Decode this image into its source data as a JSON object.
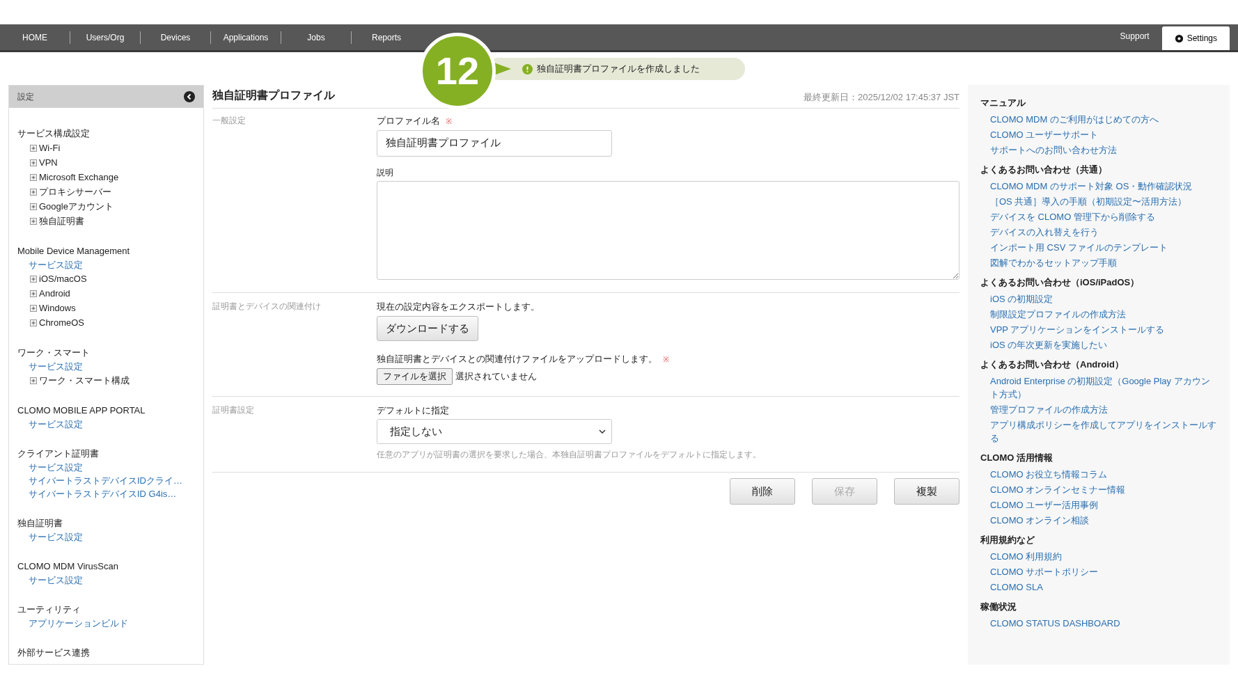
{
  "nav": {
    "left": [
      {
        "label": "HOME",
        "selected": false
      },
      {
        "label": "Users/Org",
        "selected": false
      },
      {
        "label": "Devices",
        "selected": false
      },
      {
        "label": "Applications",
        "selected": false
      },
      {
        "label": "Jobs",
        "selected": false
      },
      {
        "label": "Reports",
        "selected": false
      }
    ],
    "right": [
      {
        "label": "Support",
        "selected": false,
        "icon": false
      },
      {
        "label": "Settings",
        "selected": true,
        "icon": true
      }
    ]
  },
  "step_badge": "12",
  "toast": {
    "message": "独自証明書プロファイルを作成しました"
  },
  "sidebar": {
    "title": "設定",
    "sections": [
      {
        "title": "サービス構成設定",
        "items": [
          {
            "label": "Wi-Fi",
            "kind": "tree"
          },
          {
            "label": "VPN",
            "kind": "tree"
          },
          {
            "label": "Microsoft Exchange",
            "kind": "tree"
          },
          {
            "label": "プロキシサーバー",
            "kind": "tree"
          },
          {
            "label": "Googleアカウント",
            "kind": "tree"
          },
          {
            "label": "独自証明書",
            "kind": "tree"
          }
        ]
      },
      {
        "title": "Mobile Device Management",
        "items": [
          {
            "label": "サービス設定",
            "kind": "link"
          },
          {
            "label": "iOS/macOS",
            "kind": "tree"
          },
          {
            "label": "Android",
            "kind": "tree"
          },
          {
            "label": "Windows",
            "kind": "tree"
          },
          {
            "label": "ChromeOS",
            "kind": "tree"
          }
        ]
      },
      {
        "title": "ワーク・スマート",
        "items": [
          {
            "label": "サービス設定",
            "kind": "link"
          },
          {
            "label": "ワーク・スマート構成",
            "kind": "tree"
          }
        ]
      },
      {
        "title": "CLOMO MOBILE APP PORTAL",
        "items": [
          {
            "label": "サービス設定",
            "kind": "link"
          }
        ]
      },
      {
        "title": "クライアント証明書",
        "items": [
          {
            "label": "サービス設定",
            "kind": "link"
          },
          {
            "label": "サイバートラストデバイスIDクライ…",
            "kind": "link"
          },
          {
            "label": "サイバートラストデバイスID G4is…",
            "kind": "link"
          }
        ]
      },
      {
        "title": "独自証明書",
        "items": [
          {
            "label": "サービス設定",
            "kind": "link"
          }
        ]
      },
      {
        "title": "CLOMO MDM VirusScan",
        "items": [
          {
            "label": "サービス設定",
            "kind": "link"
          }
        ]
      },
      {
        "title": "ユーティリティ",
        "items": [
          {
            "label": "アプリケーションビルド",
            "kind": "link"
          }
        ]
      },
      {
        "title": "外部サービス連携"
      }
    ]
  },
  "main": {
    "title": "独自証明書プロファイル",
    "updated": "最終更新日：2025/12/02 17:45:37 JST",
    "general": {
      "label": "一般設定",
      "name_label": "プロファイル名",
      "required_mark": "※",
      "name_value": "独自証明書プロファイル",
      "desc_label": "説明"
    },
    "association": {
      "label": "証明書とデバイスの関連付け",
      "export_text": "現在の設定内容をエクスポートします。",
      "download_button": "ダウンロードする",
      "upload_text": "独自証明書とデバイスとの関連付けファイルをアップロードします。",
      "required_mark": "※",
      "file_button": "ファイルを選択",
      "file_status": "選択されていません"
    },
    "cert": {
      "label": "証明書設定",
      "default_label": "デフォルトに指定",
      "default_value": "指定しない",
      "hint": "任意のアプリが証明書の選択を要求した場合、本独自証明書プロファイルをデフォルトに指定します。"
    },
    "buttons": [
      {
        "label": "削除",
        "disabled": false
      },
      {
        "label": "保存",
        "disabled": true
      },
      {
        "label": "複製",
        "disabled": false
      }
    ]
  },
  "help": [
    {
      "title": "マニュアル",
      "links": [
        "CLOMO MDM のご利用がはじめての方へ",
        "CLOMO ユーザーサポート",
        "サポートへのお問い合わせ方法"
      ]
    },
    {
      "title": "よくあるお問い合わせ（共通）",
      "links": [
        "CLOMO MDM のサポート対象 OS・動作確認状況",
        "［OS 共通］導入の手順（初期設定〜活用方法）",
        "デバイスを CLOMO 管理下から削除する",
        "デバイスの入れ替えを行う",
        "インポート用 CSV ファイルのテンプレート",
        "図解でわかるセットアップ手順"
      ]
    },
    {
      "title": "よくあるお問い合わせ（iOS/iPadOS）",
      "links": [
        "iOS の初期設定",
        "制限設定プロファイルの作成方法",
        "VPP アプリケーションをインストールする",
        "iOS の年次更新を実施したい"
      ]
    },
    {
      "title": "よくあるお問い合わせ（Android）",
      "links": [
        "Android Enterprise の初期設定（Google Play アカウント方式）",
        "管理プロファイルの作成方法",
        "アプリ構成ポリシーを作成してアプリをインストールする"
      ]
    },
    {
      "title": "CLOMO 活用情報",
      "links": [
        "CLOMO お役立ち情報コラム",
        "CLOMO オンラインセミナー情報",
        "CLOMO ユーザー活用事例",
        "CLOMO オンライン相談"
      ]
    },
    {
      "title": "利用規約など",
      "links": [
        "CLOMO 利用規約",
        "CLOMO サポートポリシー",
        "CLOMO SLA"
      ]
    },
    {
      "title": "稼働状況",
      "links": [
        "CLOMO STATUS DASHBOARD"
      ]
    }
  ]
}
